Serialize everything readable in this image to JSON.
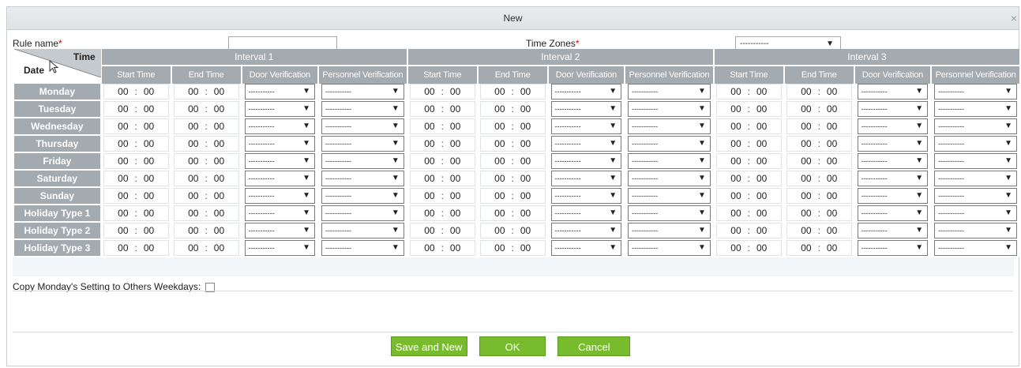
{
  "dialog": {
    "title": "New",
    "close_glyph": "×"
  },
  "form": {
    "rule_name_label": "Rule name",
    "required_mark": "*",
    "rule_name_value": "",
    "time_zones_label": "Time Zones",
    "time_zones_value": "-----------"
  },
  "table": {
    "corner_time": "Time",
    "corner_date": "Date",
    "intervals": [
      "Interval 1",
      "Interval 2",
      "Interval 3"
    ],
    "columns": [
      "Start Time",
      "End Time",
      "Door Verification",
      "Personnel Verification"
    ],
    "days": [
      "Monday",
      "Tuesday",
      "Wednesday",
      "Thursday",
      "Friday",
      "Saturday",
      "Sunday",
      "Holiday Type 1",
      "Holiday Type 2",
      "Holiday Type 3"
    ],
    "hour_value": "00",
    "minute_value": "00",
    "select_value": "-----------",
    "arrow": "▼"
  },
  "copy_label": "Copy Monday's Setting to Others Weekdays:",
  "buttons": {
    "save_new": "Save and New",
    "ok": "OK",
    "cancel": "Cancel"
  },
  "icons": {
    "cursor": "pointer-cursor-icon",
    "dropdown": "caret-down-icon"
  },
  "colors": {
    "header_gray": "#a3aab0",
    "button_green": "#78bb2c",
    "required_red": "#d40000"
  }
}
